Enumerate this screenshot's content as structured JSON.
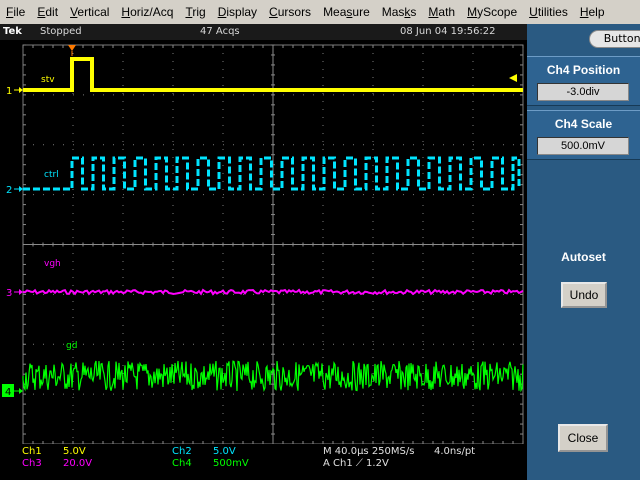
{
  "menu": [
    "File",
    "Edit",
    "Vertical",
    "Horiz/Acq",
    "Trig",
    "Display",
    "Cursors",
    "Measure",
    "Masks",
    "Math",
    "MyScope",
    "Utilities",
    "Help"
  ],
  "menu_underline": [
    "F",
    "E",
    "V",
    "H",
    "T",
    "D",
    "C",
    "s",
    "k",
    "M",
    "M",
    "U",
    "H"
  ],
  "status": {
    "brand": "Tek",
    "run_state": "Stopped",
    "acqs": "47 Acqs",
    "timestamp": "08 Jun 04 19:56:22"
  },
  "buttons_label": "Buttons",
  "ch4_position": {
    "title": "Ch4 Position",
    "value": "-3.0div"
  },
  "ch4_scale": {
    "title": "Ch4 Scale",
    "value": "500.0mV"
  },
  "autoset_label": "Autoset",
  "undo_label": "Undo",
  "close_label": "Close",
  "channels": [
    {
      "marker": "1",
      "label": "stv",
      "color": "#ffff00"
    },
    {
      "marker": "2",
      "label": "ctrl",
      "color": "#00e5ff"
    },
    {
      "marker": "3",
      "label": "vgh",
      "color": "#ff00ff"
    },
    {
      "marker": "4",
      "label": "gd",
      "color": "#00ff00"
    }
  ],
  "readout": {
    "ch1": "Ch1",
    "ch1_scale": "5.0V",
    "ch2": "Ch2",
    "ch2_scale": "5.0V",
    "ch3": "Ch3",
    "ch3_scale": "20.0V",
    "ch4": "Ch4",
    "ch4_scale": "500mV",
    "horiz": "M 40.0µs 250MS/s",
    "res": "4.0ns/pt",
    "trigger": "A  Ch1  ⟋  1.2V"
  }
}
